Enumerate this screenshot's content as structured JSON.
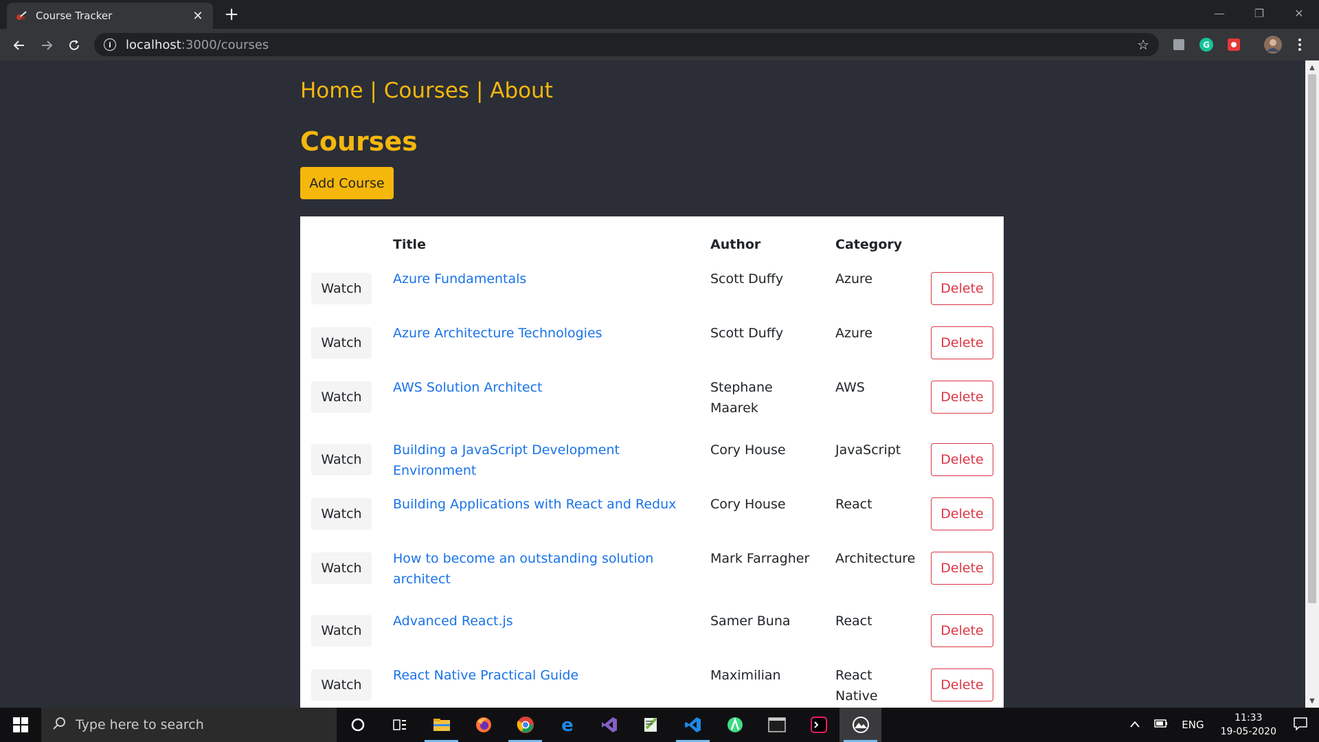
{
  "browser": {
    "tab_title": "Course Tracker",
    "url_host": "localhost",
    "url_path": ":3000/courses"
  },
  "nav": {
    "home": "Home",
    "sep1": " | ",
    "courses": "Courses",
    "sep2": " | ",
    "about": "About"
  },
  "page": {
    "title": "Courses",
    "add_button": "Add Course"
  },
  "table": {
    "headers": {
      "title": "Title",
      "author": "Author",
      "category": "Category"
    },
    "watch_label": "Watch",
    "delete_label": "Delete",
    "rows": [
      {
        "title": "Azure Fundamentals",
        "author": "Scott Duffy",
        "category": "Azure"
      },
      {
        "title": "Azure Architecture Technologies",
        "author": "Scott Duffy",
        "category": "Azure"
      },
      {
        "title": "AWS Solution Architect",
        "author": "Stephane Maarek",
        "category": "AWS"
      },
      {
        "title": "Building a JavaScript Development Environment",
        "author": "Cory House",
        "category": "JavaScript"
      },
      {
        "title": "Building Applications with React and Redux",
        "author": "Cory House",
        "category": "React"
      },
      {
        "title": "How to become an outstanding solution architect",
        "author": "Mark Farragher",
        "category": "Architecture"
      },
      {
        "title": "Advanced React.js",
        "author": "Samer Buna",
        "category": "React"
      },
      {
        "title": "React Native Practical Guide",
        "author": "Maximilian",
        "category": "React Native"
      }
    ]
  },
  "taskbar": {
    "search_placeholder": "Type here to search",
    "language": "ENG",
    "time": "11:33",
    "date": "19-05-2020"
  },
  "colors": {
    "accent": "#f5b70c",
    "page_bg": "#2b2e36",
    "link": "#1a73e8",
    "danger": "#dc3545"
  }
}
